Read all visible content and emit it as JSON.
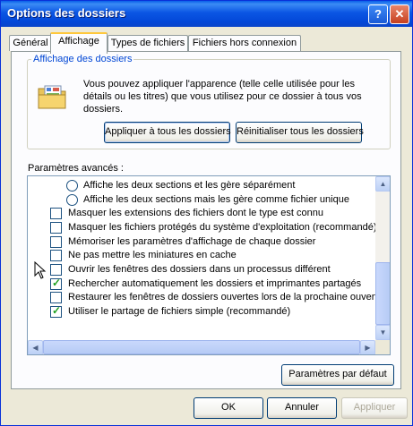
{
  "window": {
    "title": "Options des dossiers"
  },
  "titlebar_buttons": {
    "help": "?",
    "close": "✕"
  },
  "tabs": [
    {
      "label": "Général"
    },
    {
      "label": "Affichage"
    },
    {
      "label": "Types de fichiers"
    },
    {
      "label": "Fichiers hors connexion"
    }
  ],
  "folder_view": {
    "title": "Affichage des dossiers",
    "icon": "folder-view-icon",
    "description": "Vous pouvez appliquer l'apparence (telle celle utilisée pour les détails ou les titres) que vous utilisez pour ce dossier à tous vos dossiers.",
    "apply_all_label": "Appliquer à tous les dossiers",
    "reset_all_label": "Réinitialiser tous les dossiers"
  },
  "advanced": {
    "label": "Paramètres avancés :",
    "items": [
      {
        "type": "radio",
        "checked": false,
        "label": "Affiche les deux sections et les gère séparément"
      },
      {
        "type": "radio",
        "checked": false,
        "label": "Affiche les deux sections mais les gère comme fichier unique"
      },
      {
        "type": "checkbox",
        "checked": false,
        "label": "Masquer les extensions des fichiers dont le type est connu"
      },
      {
        "type": "checkbox",
        "checked": false,
        "label": "Masquer les fichiers protégés du système d'exploitation (recommandé)"
      },
      {
        "type": "checkbox",
        "checked": false,
        "label": "Mémoriser les paramètres d'affichage de chaque dossier"
      },
      {
        "type": "checkbox",
        "checked": false,
        "label": "Ne pas mettre les miniatures en cache"
      },
      {
        "type": "checkbox",
        "checked": false,
        "label": "Ouvrir les fenêtres des dossiers dans un processus différent"
      },
      {
        "type": "checkbox",
        "checked": true,
        "label": "Rechercher automatiquement les dossiers et imprimantes partagés"
      },
      {
        "type": "checkbox",
        "checked": false,
        "label": "Restaurer les fenêtres de dossiers ouvertes lors de la prochaine ouverture"
      },
      {
        "type": "checkbox",
        "checked": true,
        "label": "Utiliser le partage de fichiers simple (recommandé)"
      }
    ],
    "default_button_label": "Paramètres par défaut"
  },
  "footer": {
    "ok_label": "OK",
    "cancel_label": "Annuler",
    "apply_label": "Appliquer"
  },
  "colors": {
    "title_bar": "#0054e3",
    "group_title": "#0046d5",
    "checkmark": "#21a121"
  }
}
